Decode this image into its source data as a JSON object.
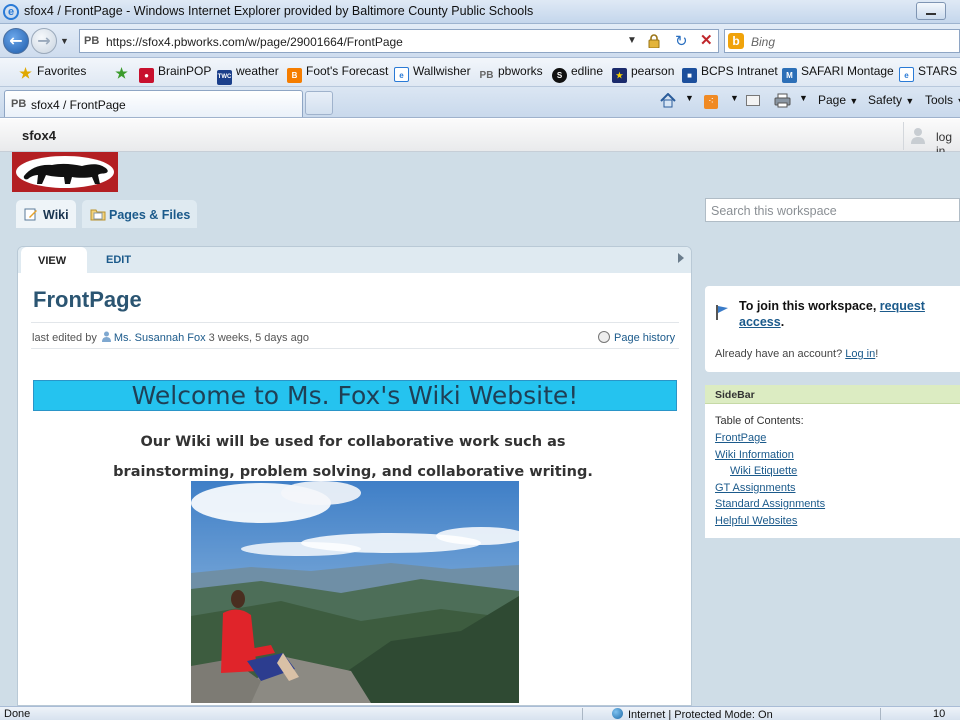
{
  "window": {
    "title": "sfox4 / FrontPage - Windows Internet Explorer provided by Baltimore County Public Schools"
  },
  "address_bar": {
    "site_badge": "PB",
    "url": "https://sfox4.pbworks.com/w/page/29001664/FrontPage",
    "search_placeholder": "Bing"
  },
  "favorites_bar": {
    "favorites_label": "Favorites",
    "items": [
      {
        "label": "BrainPOP",
        "icon": "brainpop-icon",
        "color": "#c8102e"
      },
      {
        "label": "weather",
        "icon": "twc-icon",
        "color": "#1b3f8b"
      },
      {
        "label": "Foot's Forecast",
        "icon": "blogger-icon",
        "color": "#f57d00"
      },
      {
        "label": "Wallwisher",
        "icon": "ie-page-icon",
        "color": "#2a7ad6"
      },
      {
        "label": "pbworks",
        "icon": "pb-icon",
        "color": "#888888"
      },
      {
        "label": "edline",
        "icon": "edline-icon",
        "color": "#111111"
      },
      {
        "label": "pearson",
        "icon": "pearson-icon",
        "color": "#1a2a6c"
      },
      {
        "label": "BCPS Intranet",
        "icon": "bcps-icon",
        "color": "#1c4f9c"
      },
      {
        "label": "SAFARI Montage",
        "icon": "safari-montage-icon",
        "color": "#2c6fb7"
      },
      {
        "label": "STARS L",
        "icon": "ie-page-icon",
        "color": "#2a7ad6"
      }
    ]
  },
  "tab_bar": {
    "active_tab": {
      "badge": "PB",
      "label": "sfox4 / FrontPage"
    },
    "commands": {
      "page": "Page",
      "safety": "Safety",
      "tools": "Tools"
    }
  },
  "pbworks": {
    "workspace_name": "sfox4",
    "login_label": "log in",
    "workspace_tabs": {
      "wiki": "Wiki",
      "pages": "Pages & Files"
    },
    "search_placeholder": "Search this workspace",
    "page_tabs": {
      "view": "VIEW",
      "edit": "EDIT"
    },
    "page_title": "FrontPage",
    "meta": {
      "prefix": "last edited by",
      "author": "Ms. Susannah Fox",
      "when": "3 weeks, 5 days ago",
      "history": "Page history"
    },
    "content": {
      "welcome": "Welcome to Ms. Fox's Wiki Website!",
      "intro_line_1": "Our Wiki will be used for collaborative work such as",
      "intro_line_2": "brainstorming, problem solving, and collaborative writing."
    },
    "join": {
      "text": "To join this workspace,",
      "link": "request access",
      "suffix": ".",
      "account_text": "Already have an account?",
      "login_link": "Log in",
      "account_suffix": "!"
    },
    "sidebar": {
      "heading": "SideBar",
      "toc_title": "Table of Contents:",
      "links": [
        "FrontPage",
        "Wiki Information",
        "Wiki Etiquette",
        "GT Assignments",
        "Standard Assignments",
        "Helpful Websites"
      ]
    }
  },
  "status_bar": {
    "status": "Done",
    "zone": "Internet | Protected Mode: On",
    "zoom": "10"
  },
  "colors": {
    "welcome_banner": "#25c3ef",
    "link": "#1b5a8b",
    "logo_red": "#b31f23",
    "sidebar_header": "#dcecc2"
  }
}
